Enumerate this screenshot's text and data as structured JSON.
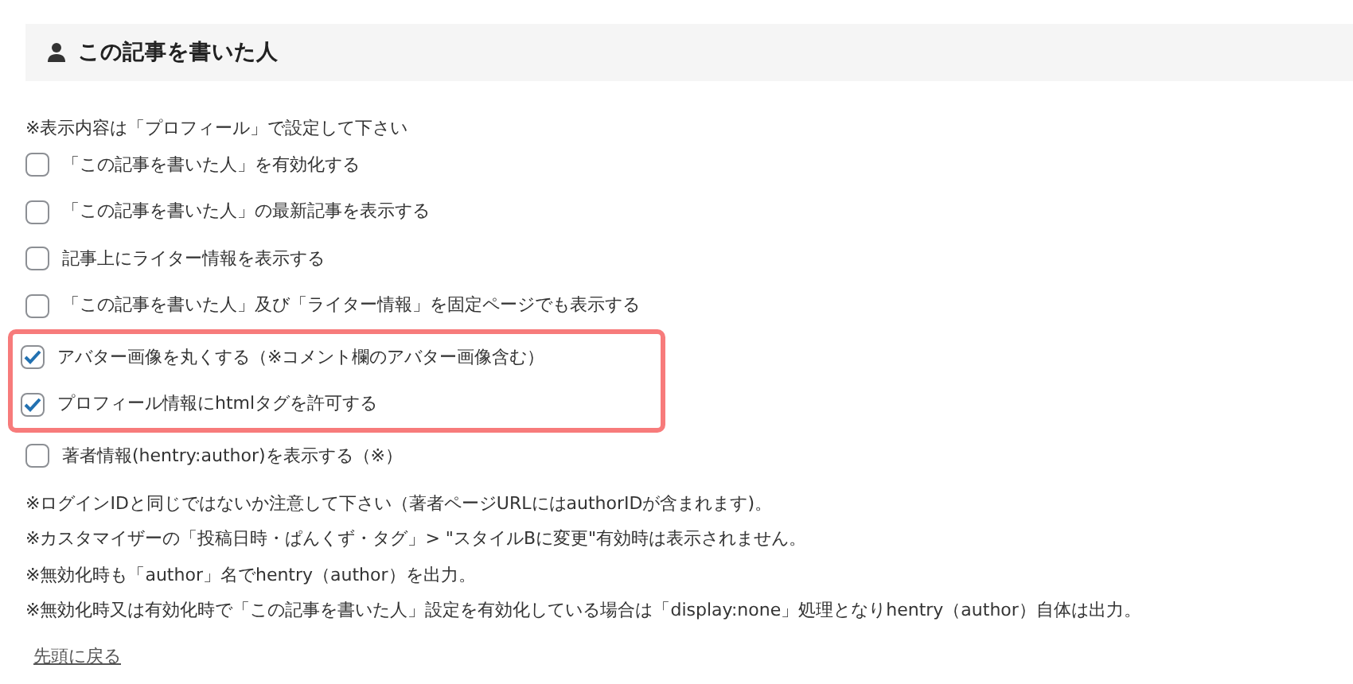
{
  "section": {
    "title": "この記事を書いた人"
  },
  "notice": "※表示内容は「プロフィール」で設定して下さい",
  "options": [
    {
      "label": "「この記事を書いた人」を有効化する",
      "checked": false,
      "highlighted": false
    },
    {
      "label": "「この記事を書いた人」の最新記事を表示する",
      "checked": false,
      "highlighted": false
    },
    {
      "label": "記事上にライター情報を表示する",
      "checked": false,
      "highlighted": false
    },
    {
      "label": "「この記事を書いた人」及び「ライター情報」を固定ページでも表示する",
      "checked": false,
      "highlighted": false
    },
    {
      "label": "アバター画像を丸くする（※コメント欄のアバター画像含む）",
      "checked": true,
      "highlighted": true
    },
    {
      "label": "プロフィール情報にhtmlタグを許可する",
      "checked": true,
      "highlighted": true
    },
    {
      "label": "著者情報(hentry:author)を表示する（※）",
      "checked": false,
      "highlighted": false
    }
  ],
  "notes": [
    "※ログインIDと同じではないか注意して下さい（著者ページURLにはauthorIDが含まれます)。",
    "※カスタマイザーの「投稿日時・ぱんくず・タグ」> \"スタイルBに変更\"有効時は表示されません。",
    "※無効化時も「author」名でhentry（author）を出力。",
    "※無効化時又は有効化時で「この記事を書いた人」設定を有効化している場合は「display:none」処理となりhentry（author）自体は出力。"
  ],
  "back_link": "先頭に戻る"
}
